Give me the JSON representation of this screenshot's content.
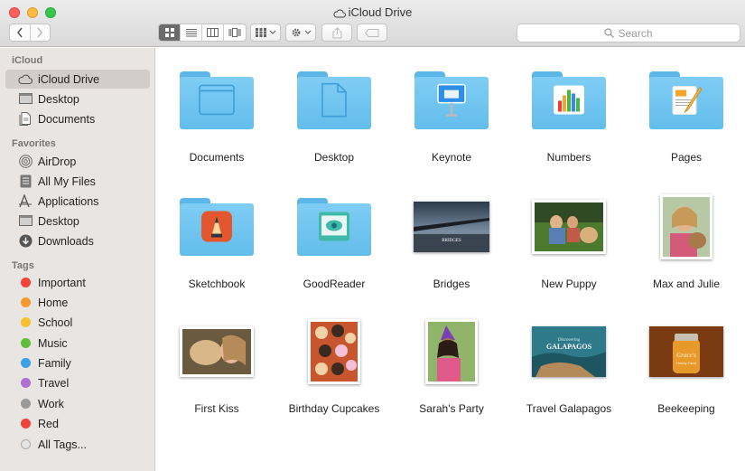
{
  "window": {
    "title": "iCloud Drive"
  },
  "toolbar": {
    "search_placeholder": "Search",
    "view_icons": [
      "icon-view",
      "list-view",
      "column-view",
      "cover-flow-view"
    ]
  },
  "sidebar": {
    "sections": [
      {
        "heading": "iCloud",
        "items": [
          {
            "label": "iCloud Drive",
            "icon": "cloud-icon",
            "selected": true
          },
          {
            "label": "Desktop",
            "icon": "desktop-icon"
          },
          {
            "label": "Documents",
            "icon": "documents-icon"
          }
        ]
      },
      {
        "heading": "Favorites",
        "items": [
          {
            "label": "AirDrop",
            "icon": "airdrop-icon"
          },
          {
            "label": "All My Files",
            "icon": "all-files-icon"
          },
          {
            "label": "Applications",
            "icon": "applications-icon"
          },
          {
            "label": "Desktop",
            "icon": "desktop-icon"
          },
          {
            "label": "Downloads",
            "icon": "downloads-icon"
          }
        ]
      },
      {
        "heading": "Tags",
        "items": [
          {
            "label": "Important",
            "color": "#f0433a"
          },
          {
            "label": "Home",
            "color": "#f79a2b"
          },
          {
            "label": "School",
            "color": "#f6c12f"
          },
          {
            "label": "Music",
            "color": "#5fbf3c"
          },
          {
            "label": "Family",
            "color": "#3aa0e8"
          },
          {
            "label": "Travel",
            "color": "#b16fd3"
          },
          {
            "label": "Work",
            "color": "#9a9a9a"
          },
          {
            "label": "Red",
            "color": "#f0433a"
          },
          {
            "label": "All Tags...",
            "color": "#e0e0e0"
          }
        ]
      }
    ]
  },
  "items": [
    {
      "label": "Documents",
      "kind": "folder",
      "icon": "window-icon"
    },
    {
      "label": "Desktop",
      "kind": "folder",
      "icon": "document-icon"
    },
    {
      "label": "Keynote",
      "kind": "folder",
      "icon": "keynote-icon"
    },
    {
      "label": "Numbers",
      "kind": "folder",
      "icon": "numbers-icon"
    },
    {
      "label": "Pages",
      "kind": "folder",
      "icon": "pages-icon"
    },
    {
      "label": "Sketchbook",
      "kind": "folder",
      "icon": "sketchbook-icon"
    },
    {
      "label": "GoodReader",
      "kind": "folder",
      "icon": "goodreader-icon"
    },
    {
      "label": "Bridges",
      "kind": "image"
    },
    {
      "label": "New Puppy",
      "kind": "photo"
    },
    {
      "label": "Max and Julie",
      "kind": "photo"
    },
    {
      "label": "First Kiss",
      "kind": "photo"
    },
    {
      "label": "Birthday Cupcakes",
      "kind": "photo"
    },
    {
      "label": "Sarah's Party",
      "kind": "photo"
    },
    {
      "label": "Travel Galapagos",
      "kind": "image"
    },
    {
      "label": "Beekeeping",
      "kind": "image"
    }
  ],
  "image_text": {
    "bridges": "BRIDGES",
    "galapagos_pre": "Discovering",
    "galapagos": "GALAPAGOS",
    "beekeeping_script": "Grace's",
    "beekeeping_sub": "Honey Farm"
  }
}
